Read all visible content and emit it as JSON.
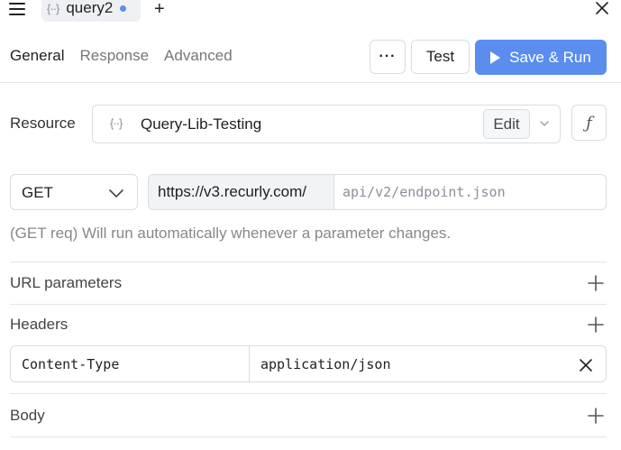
{
  "topbar": {
    "menu_icon": "hamburger-icon",
    "tab": {
      "icon": "query-braces-icon",
      "icon_glyph": "{··}",
      "label": "query2",
      "unsaved_dot_color": "#5b8def"
    },
    "new_tab_icon": "plus-icon",
    "new_tab_glyph": "+",
    "close_icon": "close-icon"
  },
  "header": {
    "tabs": [
      {
        "label": "General",
        "active": true
      },
      {
        "label": "Response",
        "active": false
      },
      {
        "label": "Advanced",
        "active": false
      }
    ],
    "more_label": "···",
    "test_label": "Test",
    "save_run_label": "Save & Run",
    "save_run_icon": "play-icon",
    "accent_color": "#5b8def"
  },
  "resource": {
    "label": "Resource",
    "icon_glyph": "{··}",
    "name": "Query-Lib-Testing",
    "edit_label": "Edit",
    "chevron_icon": "chevron-down-icon",
    "fx_label": "ƒ"
  },
  "request": {
    "method": "GET",
    "base_url": "https://v3.recurly.com/",
    "path_placeholder": "api/v2/endpoint.json",
    "path_value": "",
    "hint": "(GET req) Will run automatically whenever a parameter changes."
  },
  "sections": {
    "url_parameters": "URL parameters",
    "headers": "Headers",
    "body": "Body"
  },
  "headers_rows": [
    {
      "key": "Content-Type",
      "value": "application/json"
    }
  ]
}
